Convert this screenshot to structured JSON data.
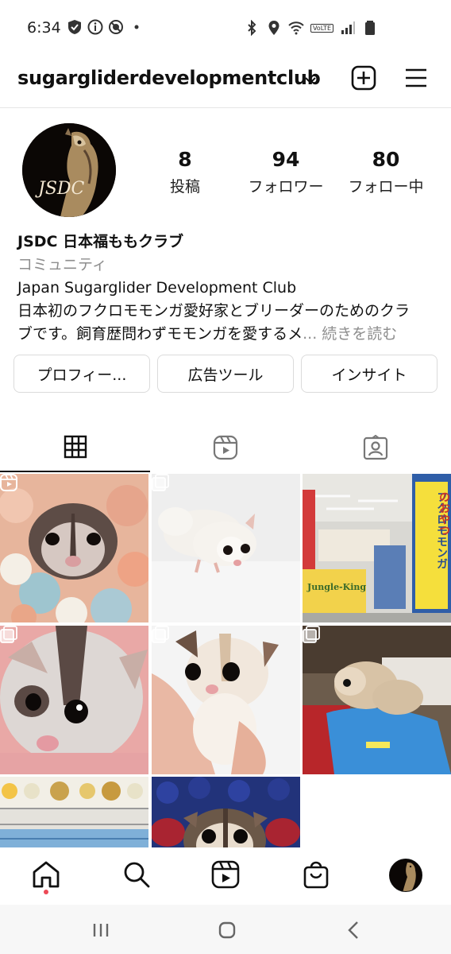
{
  "status_bar": {
    "time": "6:34",
    "left_icons": [
      "shield-icon",
      "info-icon",
      "mute-icon",
      "dot-icon"
    ],
    "right_icons": [
      "bluetooth-icon",
      "location-icon",
      "wifi-icon",
      "volte-icon",
      "signal-icon",
      "battery-icon"
    ],
    "volte_label": "VoLTE"
  },
  "header": {
    "username": "sugargliderdevelopmentclub"
  },
  "profile": {
    "avatar_text": "JSDC",
    "stats": [
      {
        "value": "8",
        "label": "投稿"
      },
      {
        "value": "94",
        "label": "フォロワー"
      },
      {
        "value": "80",
        "label": "フォロー中"
      }
    ],
    "name": "JSDC 日本福ももクラブ",
    "category": "コミュニティ",
    "bio_line1": "Japan Sugarglider Development Club",
    "bio_line2": "日本初のフクロモモンガ愛好家とブリーダーのためのクラ",
    "bio_line3": "ブです。飼育歴問わずモモンガを愛するメ",
    "bio_more": "... 続きを読む"
  },
  "actions": {
    "profile_button": "プロフィー...",
    "ads_button": "広告ツール",
    "insights_button": "インサイト"
  },
  "tabs": [
    "grid-icon",
    "reels-icon",
    "tagged-icon"
  ],
  "grid": {
    "post_badges": [
      "reel-icon",
      "carousel-icon",
      "carousel-icon",
      "carousel-icon",
      "carousel-icon",
      "carousel-icon"
    ],
    "post_3_signage": {
      "sign_line1": "フクロモモンガ",
      "sign_line2": "のおやつ",
      "shop_logo": "Jungle-King"
    }
  },
  "bottom_nav": [
    "home-icon",
    "search-icon",
    "reels-icon",
    "shop-icon",
    "profile-avatar"
  ],
  "colors": {
    "notification_dot": "#ed4956",
    "divider": "#dbdbdb",
    "secondary_text": "#8e8e8e"
  }
}
